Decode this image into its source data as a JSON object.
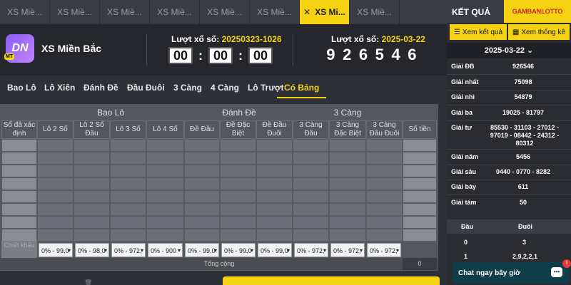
{
  "tabs": [
    "XS Miề...",
    "XS Miề...",
    "XS Miề...",
    "XS Miề...",
    "XS Miề...",
    "XS Miề...",
    "XS Mi...",
    "XS Miề..."
  ],
  "active_tab_index": 6,
  "header": {
    "title": "XS Miền Bắc",
    "logo_text": "DN",
    "logo_badge": "MT",
    "draw_no_label": "Lượt xổ số: ",
    "draw_no_value": "20250323-1026",
    "timer": [
      "00",
      "00",
      "00"
    ],
    "draw_date_label": "Lượt xổ số: ",
    "draw_date_value": "2025-03-22",
    "numbers": [
      "9",
      "2",
      "6",
      "5",
      "4",
      "6"
    ]
  },
  "category_tabs": [
    "Bao Lô",
    "Lô Xiên",
    "Đánh Đề",
    "Đầu Đuôi",
    "3 Càng",
    "4 Càng",
    "Lô Trượt",
    "Có Bảng"
  ],
  "active_category": "Có Bảng",
  "table": {
    "groups": [
      "Bao Lô",
      "Đánh Đề",
      "3 Càng"
    ],
    "columns": [
      "Số đã xác định",
      "Lô 2 Số",
      "Lô 2 Số Đầu",
      "Lô 3 Số",
      "Lô 4 Số",
      "Đề Đầu",
      "Đề Đặc Biệt",
      "Đề Đầu Đuôi",
      "3 Càng Đầu",
      "3 Càng Đặc Biệt",
      "3 Càng Đầu Đuôi",
      "Số tiền"
    ],
    "discount_label": "Chiết khấu",
    "discounts": [
      "0% - 99,0",
      "0% - 98,0",
      "0% - 972,",
      "0% - 900",
      "0% - 99,0",
      "0% - 99,0",
      "0% - 99,0",
      "0% - 972,",
      "0% - 972,",
      "0% - 972,"
    ],
    "total_label": "Tổng cộng",
    "total_value": "0"
  },
  "sidebar": {
    "title": "KẾT QUẢ",
    "brand": "GAMBANLOTTO",
    "view_results": "Xem kết quả",
    "view_stats": "Xem thống kê",
    "date": "2025-03-22 ⌄",
    "results": [
      {
        "label": "Giải ĐB",
        "value": "926546"
      },
      {
        "label": "Giải nhất",
        "value": "75098"
      },
      {
        "label": "Giải nhì",
        "value": "54879"
      },
      {
        "label": "Giải ba",
        "value": "19025 - 81797"
      },
      {
        "label": "Giải tư",
        "value": "85530 - 31103 - 27012 - 97019 - 08442 - 24312 - 80312"
      },
      {
        "label": "Giải năm",
        "value": "5456"
      },
      {
        "label": "Giải sáu",
        "value": "0440 - 0770 - 8282"
      },
      {
        "label": "Giải bảy",
        "value": "611"
      },
      {
        "label": "Giải tám",
        "value": "50"
      }
    ],
    "dd_head": [
      "Đầu",
      "Đuôi"
    ],
    "dd_rows": [
      {
        "dau": "0",
        "duoi": "3"
      },
      {
        "dau": "1",
        "duoi": "2,9,2,2,1"
      }
    ],
    "chat": "Chat ngay bây giờ",
    "chat_badge": "1",
    "accent": "#f5d312"
  }
}
